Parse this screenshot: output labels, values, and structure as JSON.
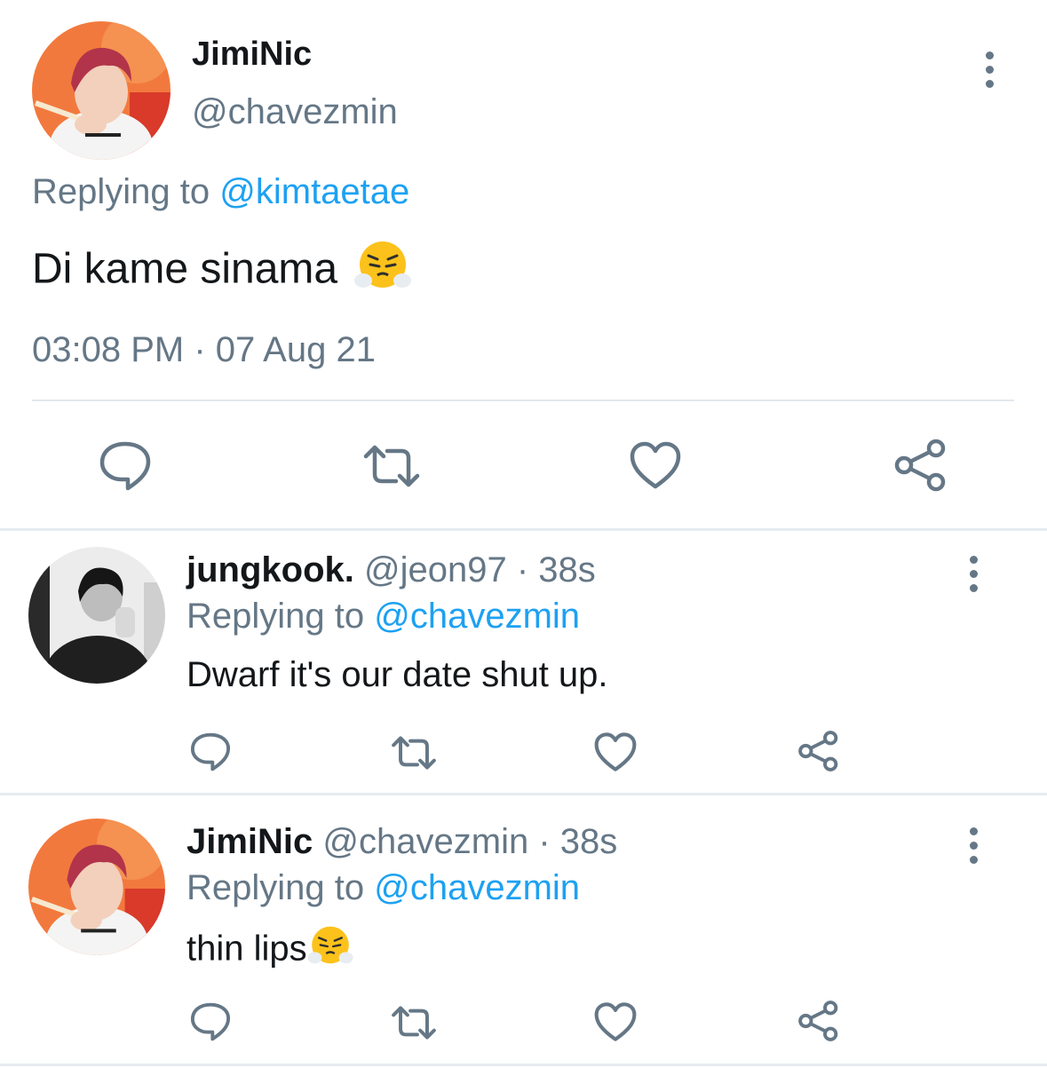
{
  "main_tweet": {
    "display_name": "JimiNic",
    "handle": "@chavezmin",
    "replying_prefix": "Replying to",
    "replying_handle": "@kimtaetae",
    "text": "Di kame sinama",
    "emoji": "face-with-steam-from-nose",
    "timestamp": "03:08 PM · 07 Aug 21"
  },
  "replies": [
    {
      "display_name": "jungkook.",
      "handle": "@jeon97",
      "time": "· 38s",
      "replying_prefix": "Replying to",
      "replying_handle": "@chavezmin",
      "text": "Dwarf it's our date shut up."
    },
    {
      "display_name": "JimiNic",
      "handle": "@chavezmin",
      "time": "· 38s",
      "replying_prefix": "Replying to",
      "replying_handle": "@chavezmin",
      "text": "thin lips",
      "emoji": "face-with-steam-from-nose"
    }
  ],
  "icons": {
    "reply": "comment-icon",
    "retweet": "retweet-icon",
    "like": "heart-icon",
    "share": "share-icon",
    "more": "more-vertical-icon"
  },
  "colors": {
    "link": "#1da1f2",
    "muted": "#657786",
    "text": "#14171a",
    "divider": "#e6ecf0"
  }
}
